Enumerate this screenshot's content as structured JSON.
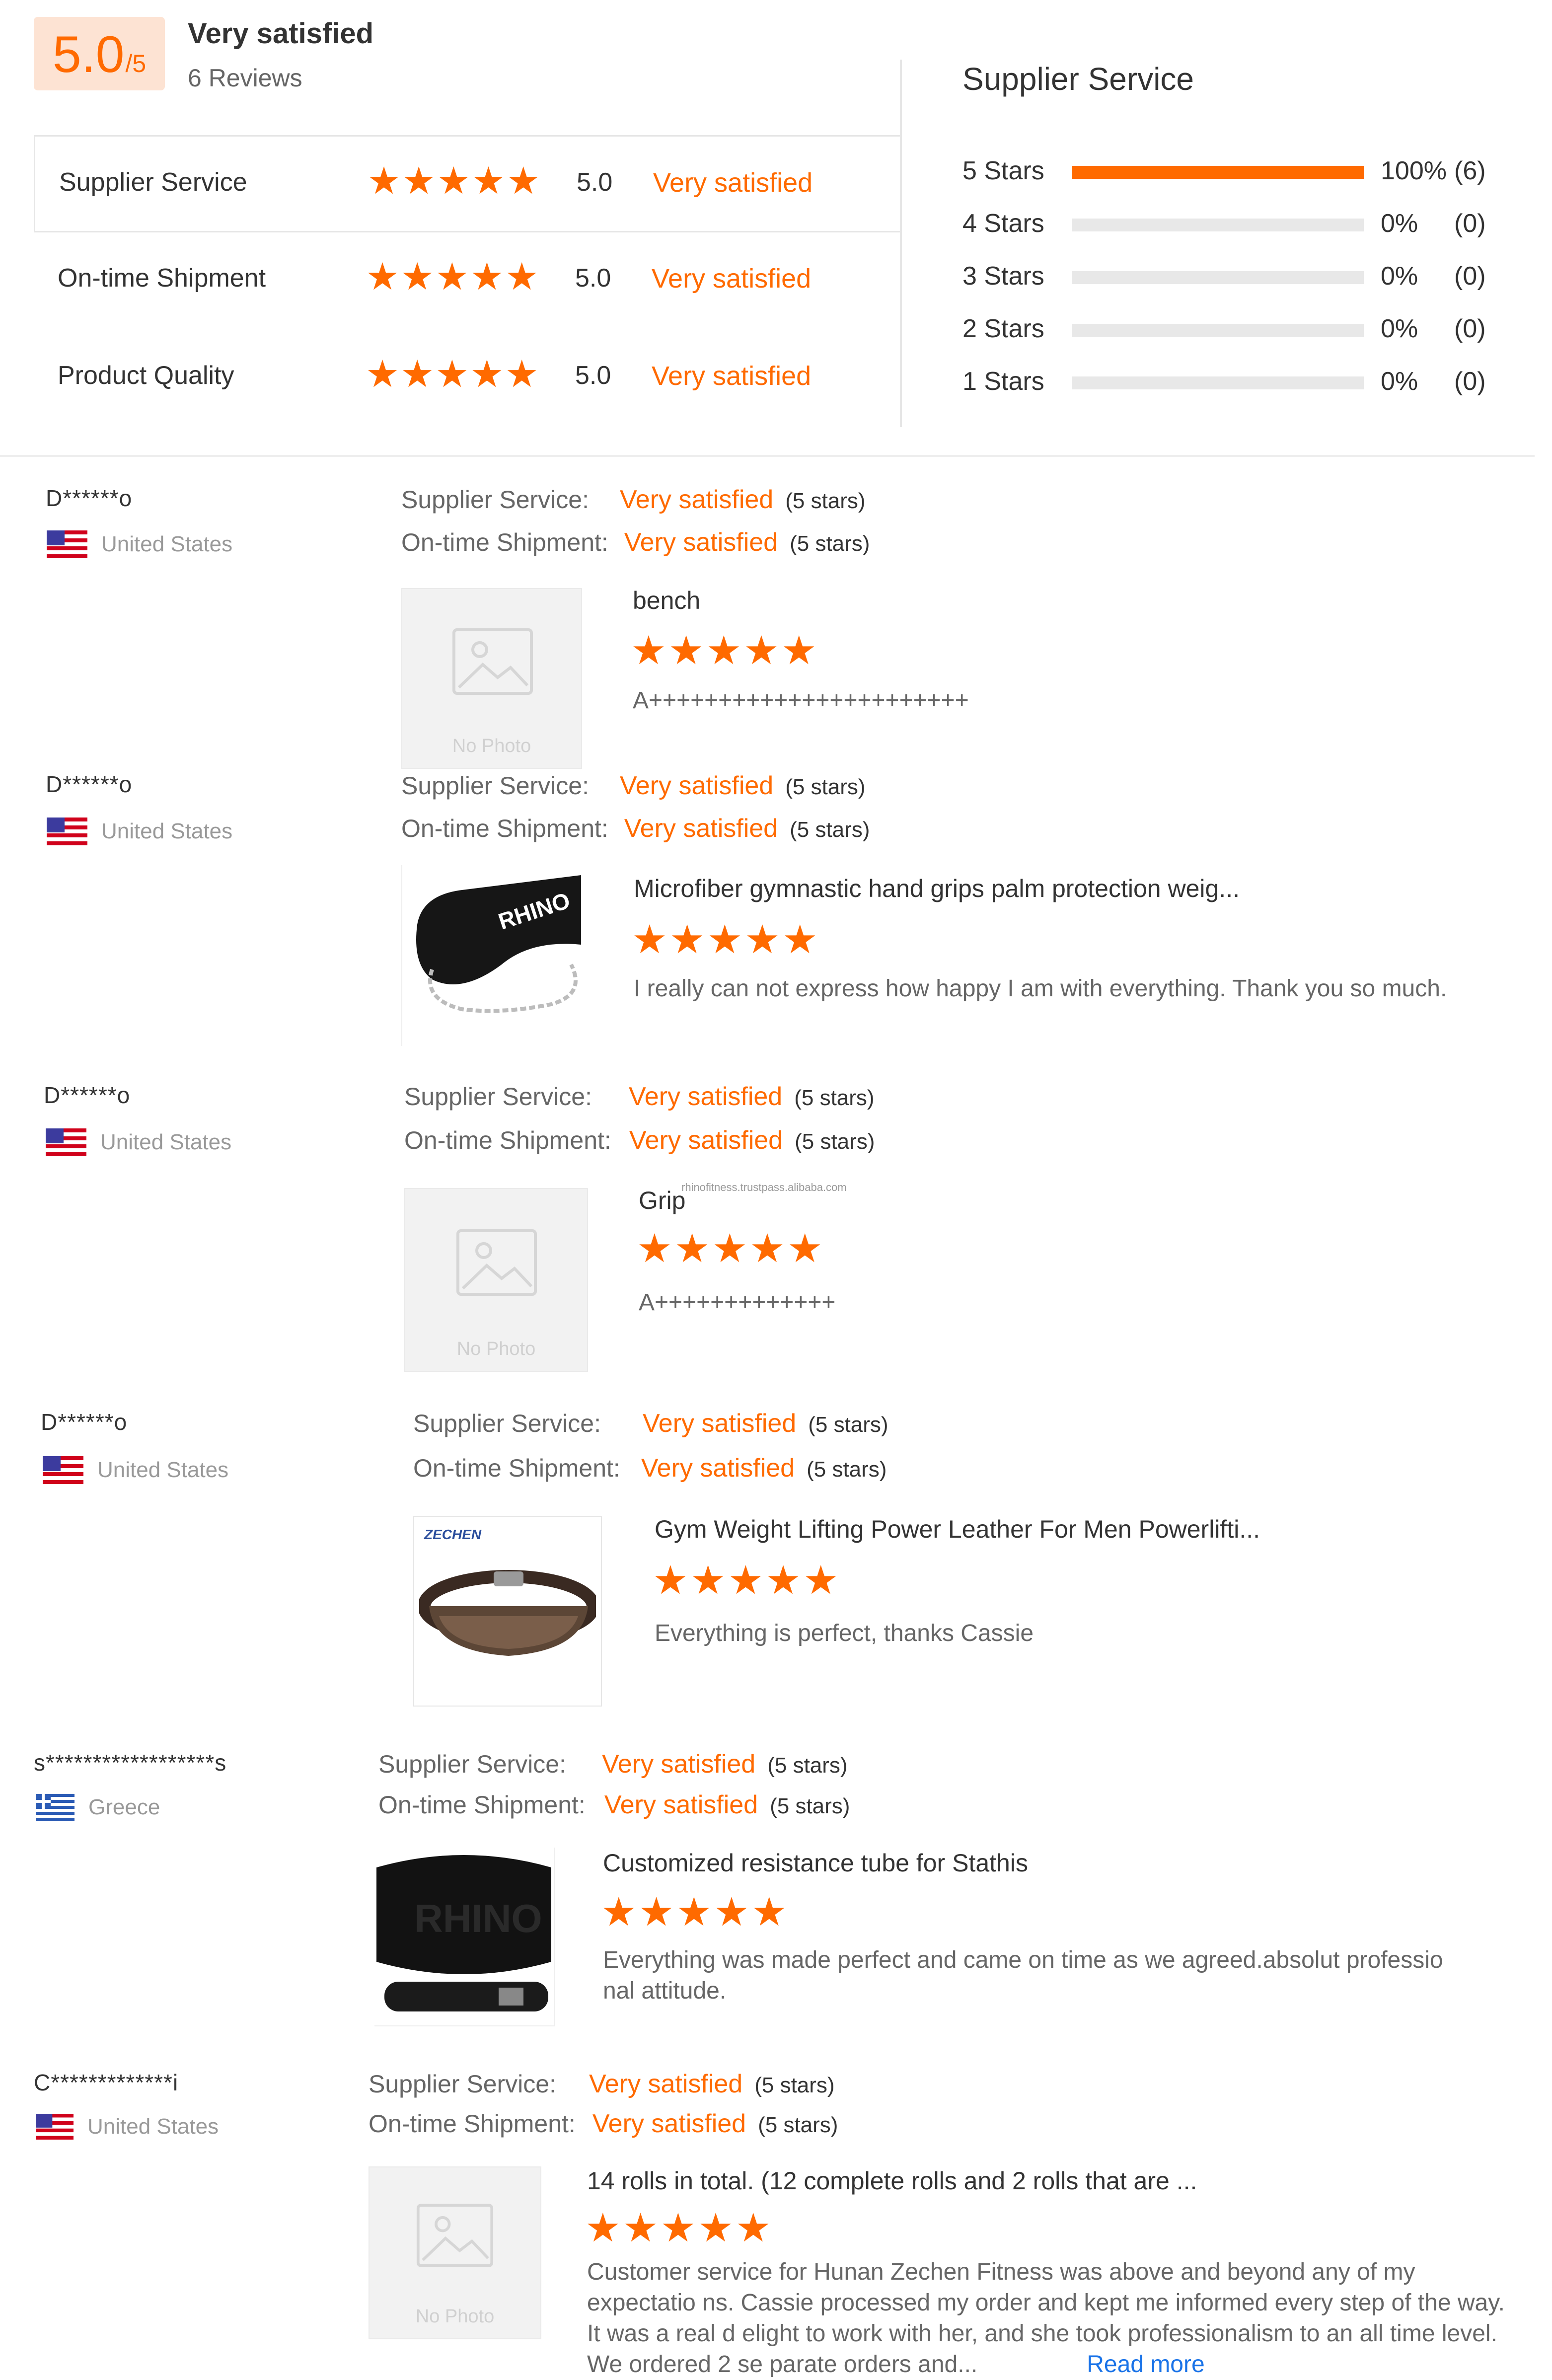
{
  "summary": {
    "score": "5.0",
    "score_max": "/5",
    "overall_label": "Very satisfied",
    "review_count": "6 Reviews"
  },
  "ratings": [
    {
      "label": "Supplier Service",
      "score": "5.0",
      "text": "Very satisfied"
    },
    {
      "label": "On-time Shipment",
      "score": "5.0",
      "text": "Very satisfied"
    },
    {
      "label": "Product Quality",
      "score": "5.0",
      "text": "Very satisfied"
    }
  ],
  "distribution": {
    "title": "Supplier Service",
    "rows": [
      {
        "label": "5 Stars",
        "percent": "100%",
        "count": "(6)",
        "fraction": 1.0
      },
      {
        "label": "4 Stars",
        "percent": "0%",
        "count": "(0)",
        "fraction": 0
      },
      {
        "label": "3 Stars",
        "percent": "0%",
        "count": "(0)",
        "fraction": 0
      },
      {
        "label": "2 Stars",
        "percent": "0%",
        "count": "(0)",
        "fraction": 0
      },
      {
        "label": "1 Stars",
        "percent": "0%",
        "count": "(0)",
        "fraction": 0
      }
    ]
  },
  "review_labels": {
    "supplier_service": "Supplier Service:",
    "ontime_shipment": "On-time Shipment:",
    "stars_text": "(5 stars)",
    "no_photo": "No Photo",
    "read_more": "Read more"
  },
  "reviews": [
    {
      "user": "D******o",
      "country": "United States",
      "supplier_service": "Very satisfied",
      "ontime_shipment": "Very satisfied",
      "product_title": "bench",
      "product_stars": 5,
      "comment": "A+++++++++++++++++++++++",
      "photo": "none"
    },
    {
      "user": "D******o",
      "country": "United States",
      "supplier_service": "Very satisfied",
      "ontime_shipment": "Very satisfied",
      "product_title": "Microfiber gymnastic hand grips palm protection weig...",
      "product_stars": 5,
      "comment": "I really can not express how happy I am with everything. Thank you so much.",
      "photo": "dip-belt"
    },
    {
      "user": "D******o",
      "country": "United States",
      "supplier_service": "Very satisfied",
      "ontime_shipment": "Very satisfied",
      "product_title": "Grip",
      "watermark": "rhinofitness.trustpass.alibaba.com",
      "product_stars": 5,
      "comment": "A+++++++++++++",
      "photo": "none"
    },
    {
      "user": "D******o",
      "country": "United States",
      "supplier_service": "Very satisfied",
      "ontime_shipment": "Very satisfied",
      "product_title": "Gym Weight Lifting Power Leather For Men Powerlifti...",
      "product_stars": 5,
      "comment": "Everything is perfect, thanks Cassie",
      "photo": "leather-belt",
      "photo_brand": "ZECHEN"
    },
    {
      "user": "s******************s",
      "country": "Greece",
      "supplier_service": "Very satisfied",
      "ontime_shipment": "Very satisfied",
      "product_title": "Customized resistance tube for Stathis",
      "product_stars": 5,
      "comment": "Everything was made perfect and came on time as we agreed.absolut professio nal attitude.",
      "photo": "black-belt"
    },
    {
      "user": "C*************i",
      "country": "United States",
      "supplier_service": "Very satisfied",
      "ontime_shipment": "Very satisfied",
      "product_title": "14 rolls in total. (12 complete rolls and 2 rolls that are ...",
      "product_stars": 5,
      "comment": "Customer service for Hunan Zechen Fitness was above and beyond any of my expectatio ns. Cassie processed my order and kept me informed every step of the way. It was a real d elight to work with her, and she took professionalism to an all time level. We ordered 2 se parate orders and...",
      "photo": "none"
    }
  ],
  "colors": {
    "accent": "#ff6a00",
    "score_bg": "#fde3d3",
    "link": "#1a73e8"
  },
  "icons": [
    "star-icon",
    "us-flag-icon",
    "greece-flag-icon",
    "no-photo-icon"
  ]
}
